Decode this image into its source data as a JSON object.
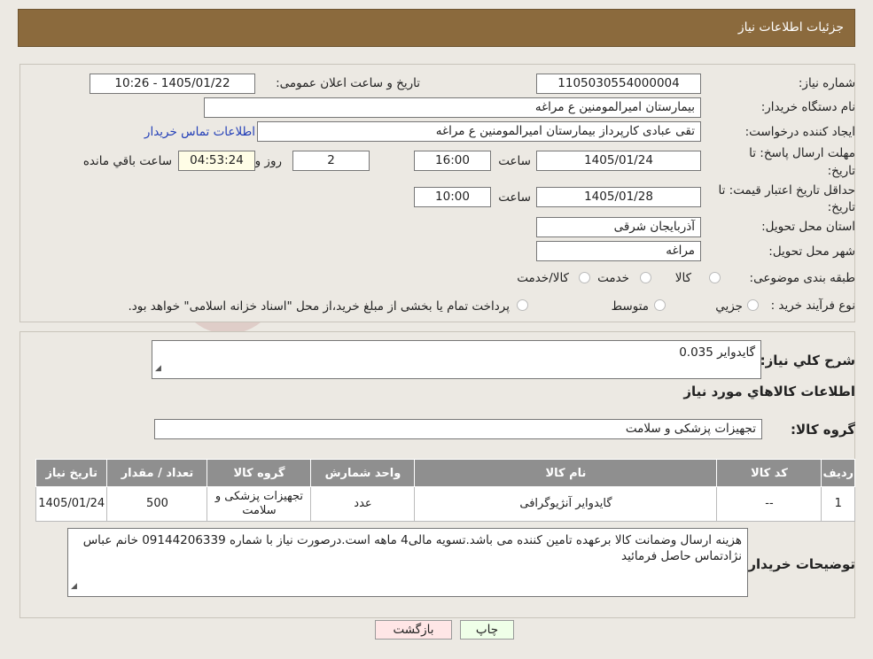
{
  "header": {
    "title": "جزئیات اطلاعات نیاز"
  },
  "watermark": {
    "text": "AriaTender.neT"
  },
  "fields": {
    "need_number_label": "شماره نیاز:",
    "need_number": "1105030554000004",
    "announce_label": "تاریخ و ساعت اعلان عمومی:",
    "announce_value": "1405/01/22 - 10:26",
    "buyer_org_label": "نام دستگاه خریدار:",
    "buyer_org": "بیمارستان امیرالمومنین ع  مراغه",
    "creator_label": "ایجاد کننده درخواست:",
    "creator": "تقی عبادی کارپرداز بیمارستان امیرالمومنین ع  مراغه",
    "contact_link": "اطلاعات تماس خریدار",
    "deadline_label_1": "مهلت ارسال پاسخ: تا",
    "deadline_label_2": "تاریخ:",
    "deadline_date": "1405/01/24",
    "time_label": "ساعت",
    "deadline_time": "16:00",
    "days_value": "2",
    "days_label": "روز و",
    "remaining_value": "04:53:24",
    "remaining_label": "ساعت باقي مانده",
    "validity_label_1": "حداقل تاریخ اعتبار قیمت: تا",
    "validity_label_2": "تاریخ:",
    "validity_date": "1405/01/28",
    "validity_time": "10:00",
    "province_label": "استان محل تحویل:",
    "province": "آذربایجان شرقی",
    "city_label": "شهر محل تحویل:",
    "city": "مراغه",
    "category_label": "طبقه بندی موضوعی:",
    "category_options": [
      "کالا",
      "خدمت",
      "کالا/خدمت"
    ],
    "process_label": "نوع فرآیند خرید :",
    "process_options": [
      "جزیي",
      "متوسط"
    ],
    "process_note": "پرداخت تمام یا بخشی از مبلغ خرید،از محل \"اسناد خزانه اسلامی\" خواهد بود."
  },
  "summary": {
    "label": "شرح کلي نياز:",
    "value": "گایدوایر 0.035"
  },
  "goods": {
    "section_title": "اطلاعات کالاهاي مورد نياز",
    "group_label": "گروه کالا:",
    "group_value": "تجهیزات پزشکی و سلامت"
  },
  "table": {
    "headers": [
      "رديف",
      "کد کالا",
      "نام کالا",
      "واحد شمارش",
      "گروه کالا",
      "تعداد / مقدار",
      "تاريخ نياز"
    ],
    "rows": [
      [
        "1",
        "--",
        "گایدوایر آنژیوگرافی",
        "عدد",
        "تجهیزات پزشکی و سلامت",
        "500",
        "1405/01/24"
      ]
    ]
  },
  "buyer_notes": {
    "label": "توضيحات خريدار:",
    "value": "هزینه ارسال وضمانت  کالا برعهده تامین کننده می باشد.تسویه مالی4 ماهه است.درصورت نیاز با شماره 09144206339 خانم عباس نژادتماس حاصل فرمائید"
  },
  "buttons": {
    "print": "چاپ",
    "back": "بازگشت"
  }
}
